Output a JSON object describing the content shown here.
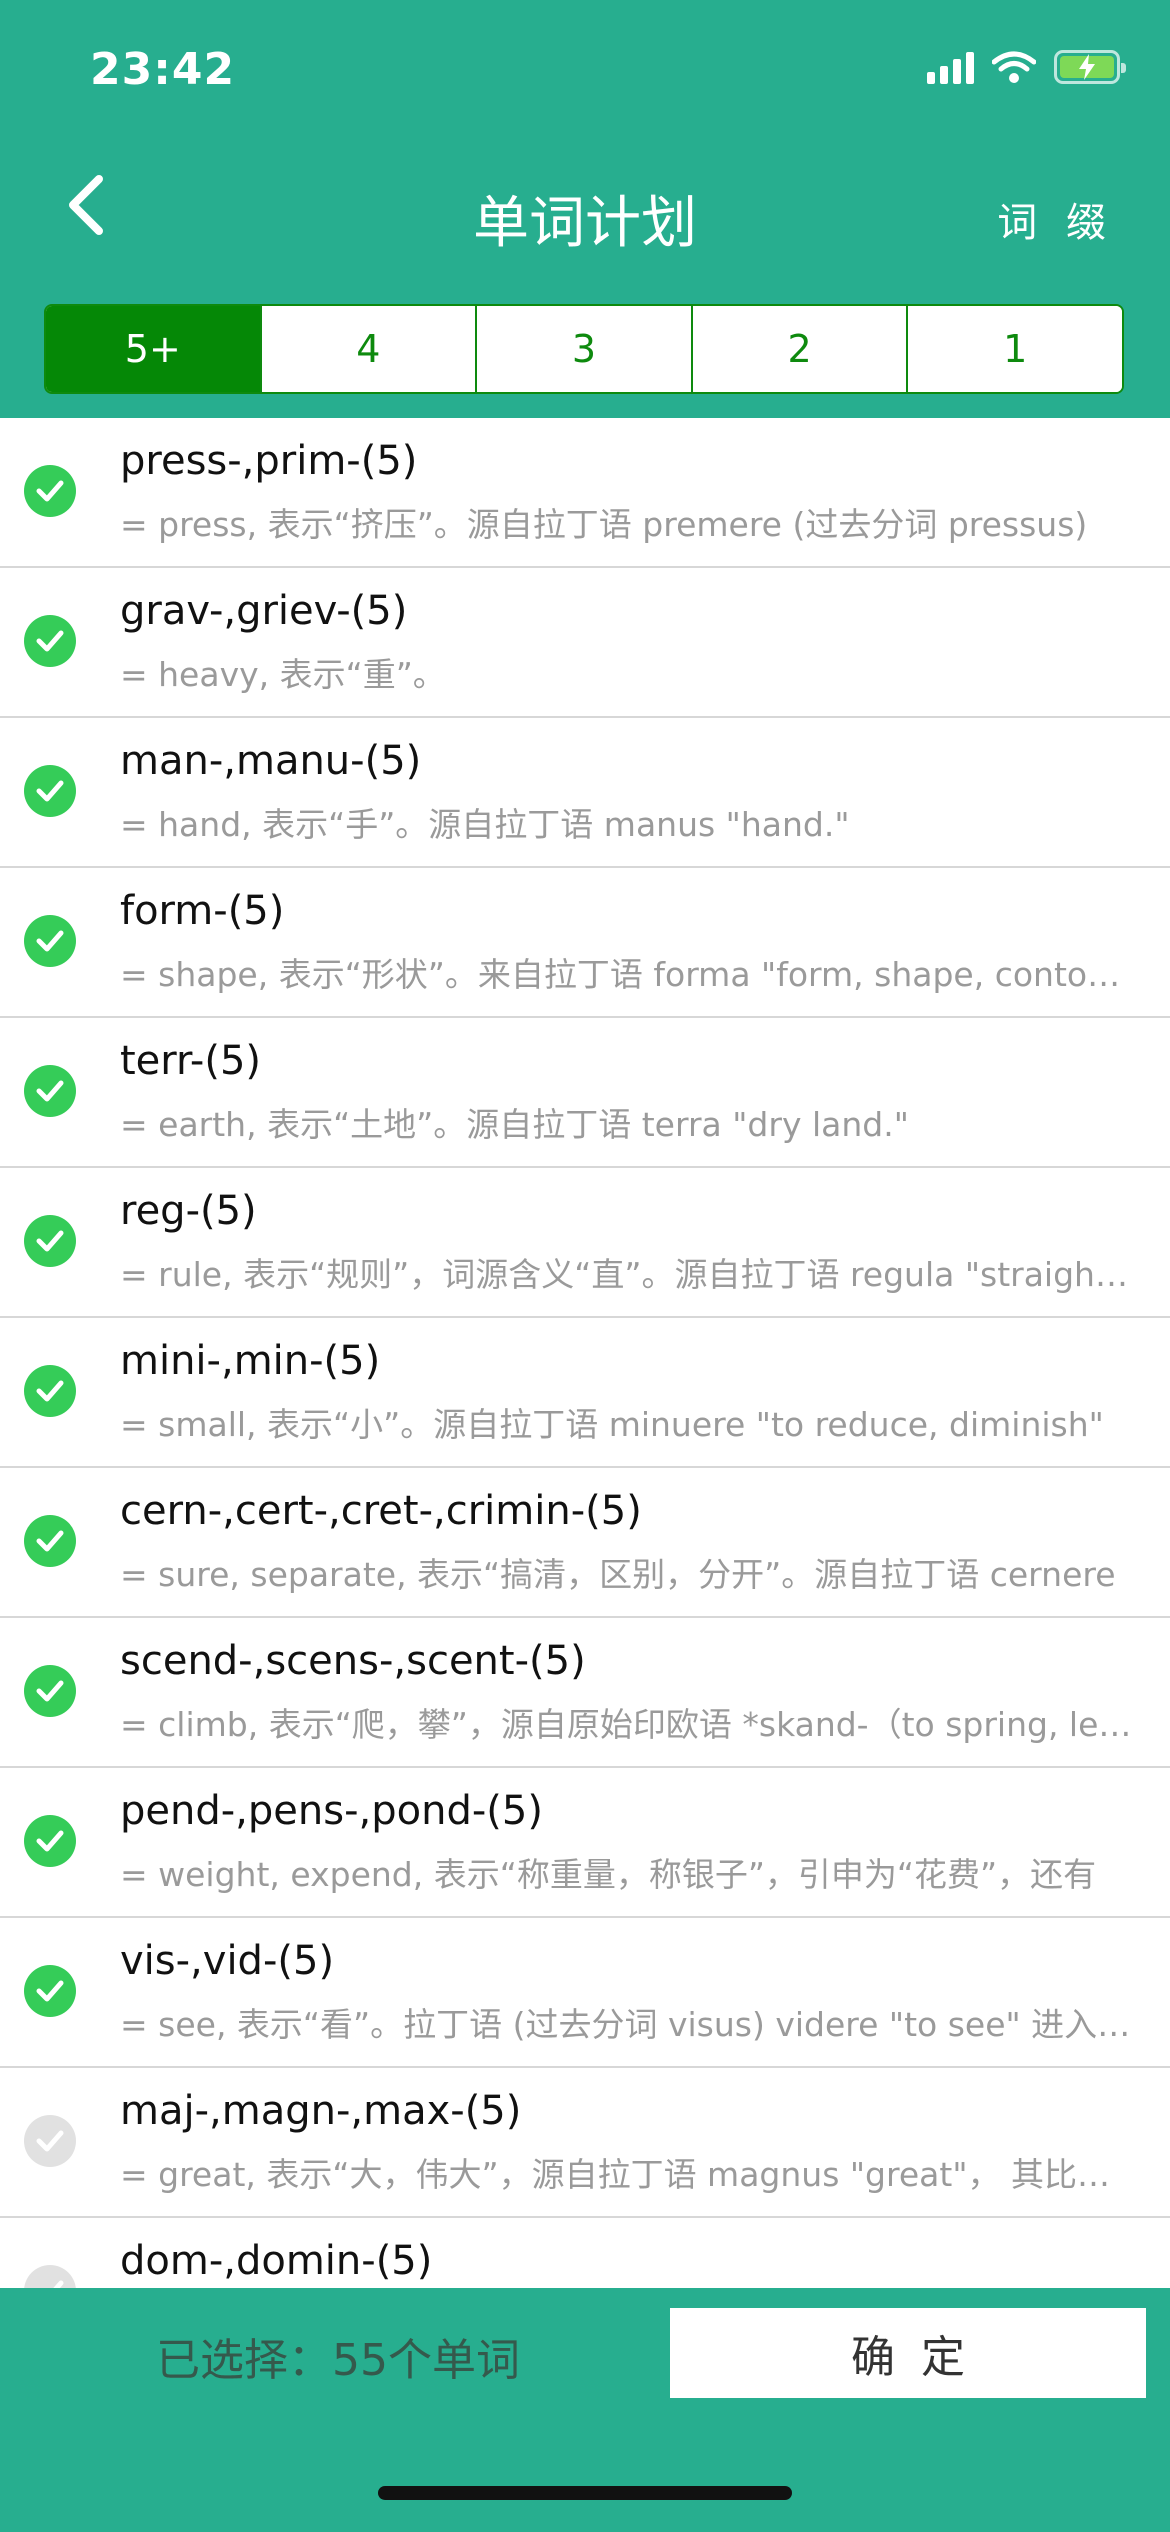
{
  "status_bar": {
    "time": "23:42"
  },
  "nav": {
    "title": "单词计划",
    "affix_label": "词 缀"
  },
  "tabs": [
    {
      "label": "5+",
      "active": true
    },
    {
      "label": "4",
      "active": false
    },
    {
      "label": "3",
      "active": false
    },
    {
      "label": "2",
      "active": false
    },
    {
      "label": "1",
      "active": false
    }
  ],
  "items": [
    {
      "title": "press-,prim-(5)",
      "desc": "= press, 表示“挤压”。源自拉丁语 premere (过去分词 pressus)",
      "checked": true
    },
    {
      "title": "grav-,griev-(5)",
      "desc": "= heavy, 表示“重”。",
      "checked": true
    },
    {
      "title": "man-,manu-(5)",
      "desc": "= hand, 表示“手”。源自拉丁语 manus \"hand.\"",
      "checked": true
    },
    {
      "title": "form-(5)",
      "desc": "= shape, 表示“形状”。来自拉丁语 forma \"form, shape, contour\"",
      "checked": true
    },
    {
      "title": "terr-(5)",
      "desc": "= earth, 表示“土地”。源自拉丁语 terra \"dry land.\"",
      "checked": true
    },
    {
      "title": "reg-(5)",
      "desc": "= rule, 表示“规则”，词源含义“直”。源自拉丁语 regula \"straight stick\"",
      "checked": true
    },
    {
      "title": "mini-,min-(5)",
      "desc": "= small, 表示“小”。源自拉丁语 minuere \"to reduce, diminish\"",
      "checked": true
    },
    {
      "title": "cern-,cert-,cret-,crimin-(5)",
      "desc": "= sure, separate, 表示“搞清，区别，分开”。源自拉丁语 cernere",
      "checked": true
    },
    {
      "title": "scend-,scens-,scent-(5)",
      "desc": "= climb, 表示“爬，攀”，源自原始印欧语 *skand-（to spring, leap）",
      "checked": true
    },
    {
      "title": "pend-,pens-,pond-(5)",
      "desc": "= weight, expend, 表示“称重量，称银子”，引申为“花费”，还有",
      "checked": true
    },
    {
      "title": "vis-,vid-(5)",
      "desc": "= see, 表示“看”。拉丁语 (过去分词 visus) videre \"to see\" 进入英语",
      "checked": true
    },
    {
      "title": "maj-,magn-,max-(5)",
      "desc": "= great, 表示“大，伟大”，源自拉丁语 magnus \"great\"， 其比较级",
      "checked": false
    },
    {
      "title": "dom-,domin-(5)",
      "desc": "",
      "checked": false
    }
  ],
  "footer": {
    "selected_text": "已选择：55个单词",
    "confirm_label": "确定"
  },
  "colors": {
    "header_bg": "#27AE8F",
    "tab_active": "#058806",
    "check_on": "#35CC58",
    "check_off": "#E1E1E1"
  }
}
